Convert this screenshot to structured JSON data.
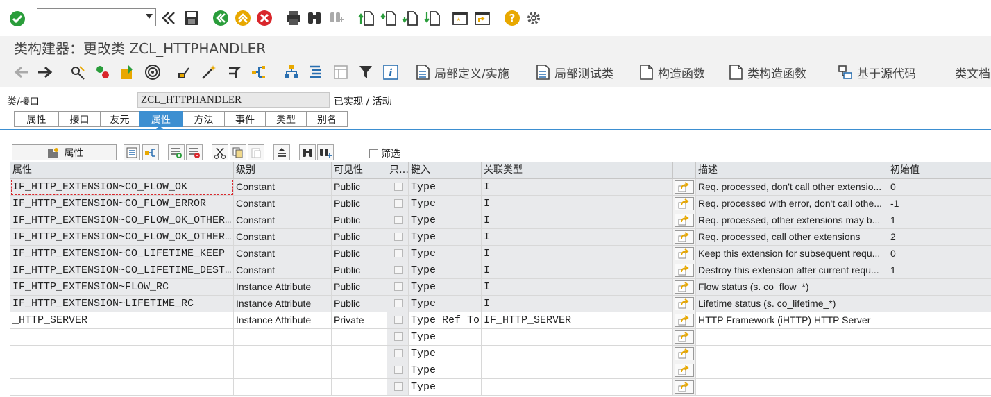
{
  "title": "类构建器：更改类 ZCL_HTTPHANDLER",
  "app_toolbar": {
    "local_definitions": "局部定义/实施",
    "local_test_classes": "局部测试类",
    "constructor": "构造函数",
    "class_constructor": "类构造函数",
    "source_based": "基于源代码",
    "class_documentation": "类文档"
  },
  "header": {
    "class_label": "类/接口",
    "class_value": "ZCL_HTTPHANDLER",
    "status": "已实现 / 活动"
  },
  "tabs": [
    "属性",
    "接口",
    "友元",
    "属性",
    "方法",
    "事件",
    "类型",
    "别名"
  ],
  "active_tab_index": 3,
  "grid_toolbar": {
    "attributes_button": "属性",
    "filter_label": "筛选"
  },
  "columns": [
    "属性",
    "级别",
    "可见性",
    "只...",
    "键入",
    "关联类型",
    "",
    "描述",
    "初始值"
  ],
  "rows": [
    {
      "attr": "IF_HTTP_EXTENSION~CO_FLOW_OK",
      "level": "Constant",
      "visibility": "Public",
      "typing": "Type",
      "assoc": "I",
      "desc": "Req. processed, don't call other extensio...",
      "init": "0"
    },
    {
      "attr": "IF_HTTP_EXTENSION~CO_FLOW_ERROR",
      "level": "Constant",
      "visibility": "Public",
      "typing": "Type",
      "assoc": "I",
      "desc": "Req. processed with error, don't call othe...",
      "init": "-1"
    },
    {
      "attr": "IF_HTTP_EXTENSION~CO_FLOW_OK_OTHERS_OPT",
      "level": "Constant",
      "visibility": "Public",
      "typing": "Type",
      "assoc": "I",
      "desc": "Req. processed, other extensions may b...",
      "init": "1"
    },
    {
      "attr": "IF_HTTP_EXTENSION~CO_FLOW_OK_OTHERS_MAND",
      "level": "Constant",
      "visibility": "Public",
      "typing": "Type",
      "assoc": "I",
      "desc": "Req. processed, call other extensions",
      "init": "2"
    },
    {
      "attr": "IF_HTTP_EXTENSION~CO_LIFETIME_KEEP",
      "level": "Constant",
      "visibility": "Public",
      "typing": "Type",
      "assoc": "I",
      "desc": "Keep this extension for subsequent requ...",
      "init": "0"
    },
    {
      "attr": "IF_HTTP_EXTENSION~CO_LIFETIME_DESTROY",
      "level": "Constant",
      "visibility": "Public",
      "typing": "Type",
      "assoc": "I",
      "desc": "Destroy this extension after current requ...",
      "init": "1"
    },
    {
      "attr": "IF_HTTP_EXTENSION~FLOW_RC",
      "level": "Instance Attribute",
      "visibility": "Public",
      "typing": "Type",
      "assoc": "I",
      "desc": "Flow status (s. co_flow_*)",
      "init": ""
    },
    {
      "attr": "IF_HTTP_EXTENSION~LIFETIME_RC",
      "level": "Instance Attribute",
      "visibility": "Public",
      "typing": "Type",
      "assoc": "I",
      "desc": "Lifetime status (s. co_lifetime_*)",
      "init": ""
    },
    {
      "attr": "_HTTP_SERVER",
      "level": "Instance Attribute",
      "visibility": "Private",
      "typing": "Type Ref To",
      "assoc": "IF_HTTP_SERVER",
      "desc": "HTTP Framework (iHTTP) HTTP Server",
      "init": ""
    },
    {
      "attr": "",
      "level": "",
      "visibility": "",
      "typing": "Type",
      "assoc": "",
      "desc": "",
      "init": ""
    },
    {
      "attr": "",
      "level": "",
      "visibility": "",
      "typing": "Type",
      "assoc": "",
      "desc": "",
      "init": ""
    },
    {
      "attr": "",
      "level": "",
      "visibility": "",
      "typing": "Type",
      "assoc": "",
      "desc": "",
      "init": ""
    },
    {
      "attr": "",
      "level": "",
      "visibility": "",
      "typing": "Type",
      "assoc": "",
      "desc": "",
      "init": ""
    }
  ]
}
